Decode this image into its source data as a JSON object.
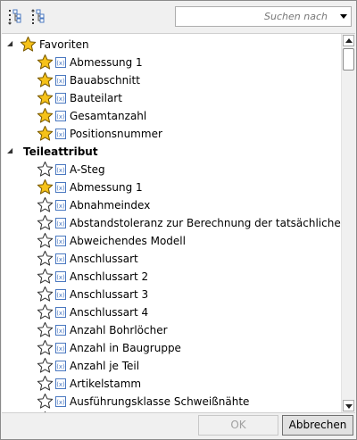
{
  "toolbar": {
    "expand_all_icon": "expand-all-icon",
    "collapse_all_icon": "collapse-all-icon",
    "search_placeholder": "Suchen nach"
  },
  "colors": {
    "star_fill": "#f6c219",
    "star_stroke": "#7a5a00",
    "attr_icon": "#4a78c0"
  },
  "favorites": {
    "label": "Favoriten",
    "items": [
      {
        "label": "Abmessung 1",
        "favorite": true
      },
      {
        "label": "Bauabschnitt",
        "favorite": true
      },
      {
        "label": "Bauteilart",
        "favorite": true
      },
      {
        "label": "Gesamtanzahl",
        "favorite": true
      },
      {
        "label": "Positionsnummer",
        "favorite": true
      }
    ]
  },
  "teileattribut": {
    "label": "Teileattribut",
    "items": [
      {
        "label": "A-Steg",
        "favorite": false
      },
      {
        "label": "Abmessung 1",
        "favorite": true
      },
      {
        "label": "Abnahmeindex",
        "favorite": false
      },
      {
        "label": "Abstandstoleranz zur Berechnung der tatsächlichen Oberf",
        "favorite": false
      },
      {
        "label": "Abweichendes Modell",
        "favorite": false
      },
      {
        "label": "Anschlussart",
        "favorite": false
      },
      {
        "label": "Anschlussart 2",
        "favorite": false
      },
      {
        "label": "Anschlussart 3",
        "favorite": false
      },
      {
        "label": "Anschlussart 4",
        "favorite": false
      },
      {
        "label": "Anzahl Bohrlöcher",
        "favorite": false
      },
      {
        "label": "Anzahl in Baugruppe",
        "favorite": false
      },
      {
        "label": "Anzahl je Teil",
        "favorite": false
      },
      {
        "label": "Artikelstamm",
        "favorite": false
      },
      {
        "label": "Ausführungsklasse Schweißnähte",
        "favorite": false
      },
      {
        "label": "",
        "favorite": false
      }
    ]
  },
  "buttons": {
    "ok": "OK",
    "cancel": "Abbrechen"
  }
}
